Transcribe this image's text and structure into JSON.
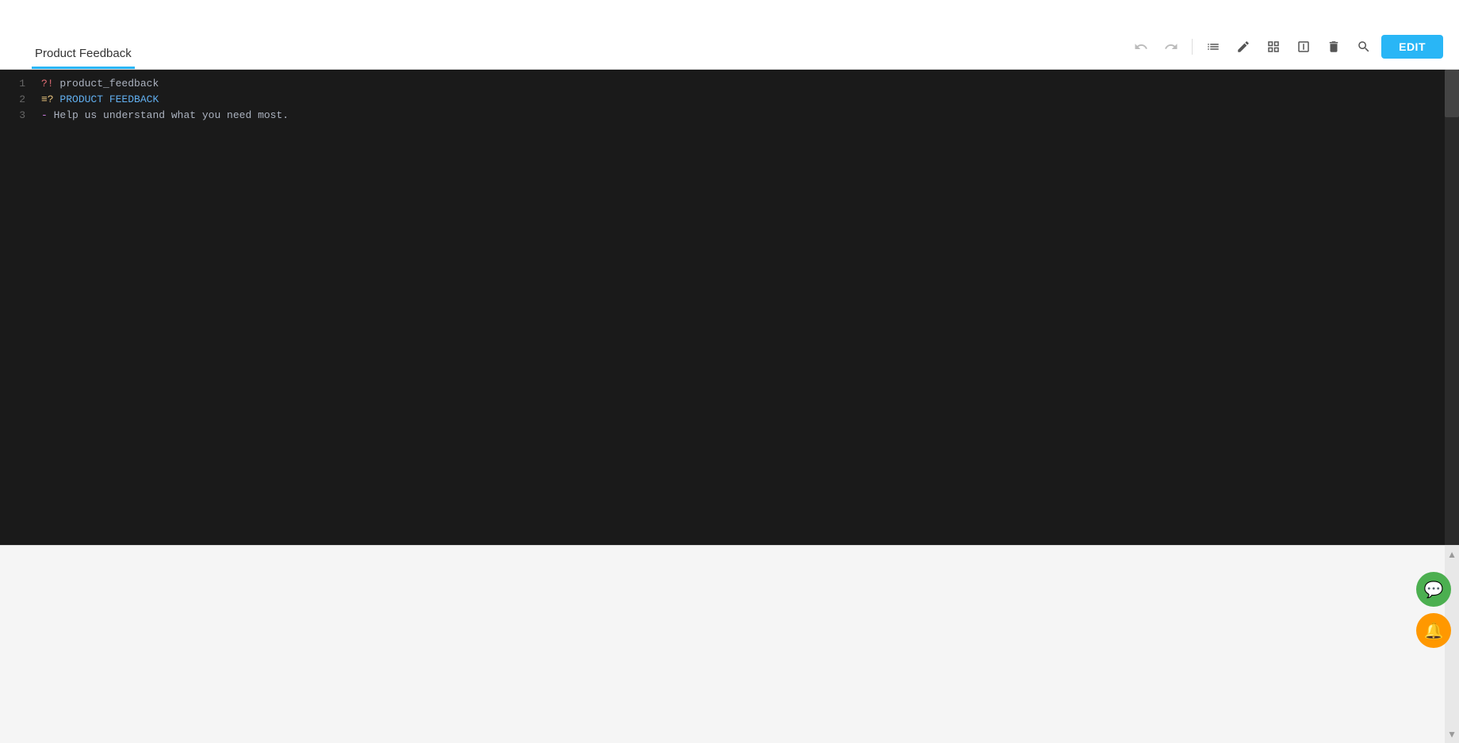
{
  "tab": {
    "label": "Product Feedback"
  },
  "toolbar": {
    "undo_label": "↩",
    "redo_label": "↪",
    "list_label": "≡",
    "pen_label": "✎",
    "grid_label": "⊞",
    "split_label": "⊟",
    "delete_label": "🗑",
    "search_label": "🔍",
    "edit_label": "EDIT"
  },
  "code": {
    "lines": [
      {
        "num": "1",
        "content": "?! product_feedback",
        "type": "directive"
      },
      {
        "num": "2",
        "content": "=? PRODUCT FEEDBACK",
        "type": "key"
      },
      {
        "num": "3",
        "content": "  - Help us understand what you need most.",
        "type": "list"
      }
    ]
  },
  "floating": {
    "chat_icon": "💬",
    "notify_icon": "🔔"
  }
}
